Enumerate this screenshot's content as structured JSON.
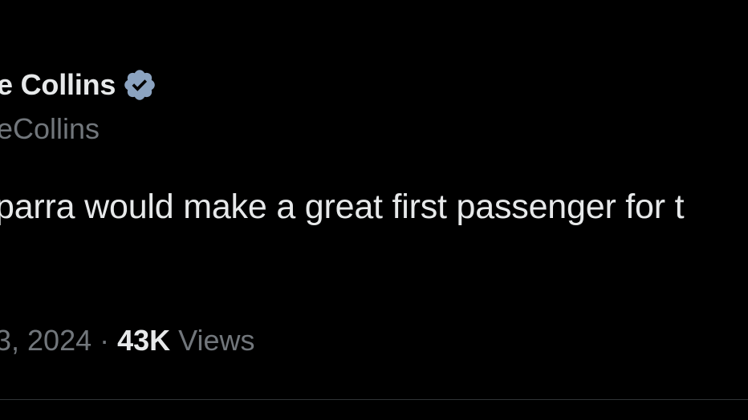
{
  "author": {
    "display_name": "e Collins",
    "handle": "eCollins",
    "verified_icon": "verified-badge-icon"
  },
  "tweet": {
    "text": "parra would make a great first passenger for t"
  },
  "meta": {
    "date": "3, 2024",
    "separator": "·",
    "view_count": "43K",
    "views_label": "Views"
  },
  "colors": {
    "background": "#000000",
    "primary_text": "#e7e9ea",
    "secondary_text": "#71767b",
    "badge": "#8ba3c0",
    "divider": "#2f3336"
  }
}
